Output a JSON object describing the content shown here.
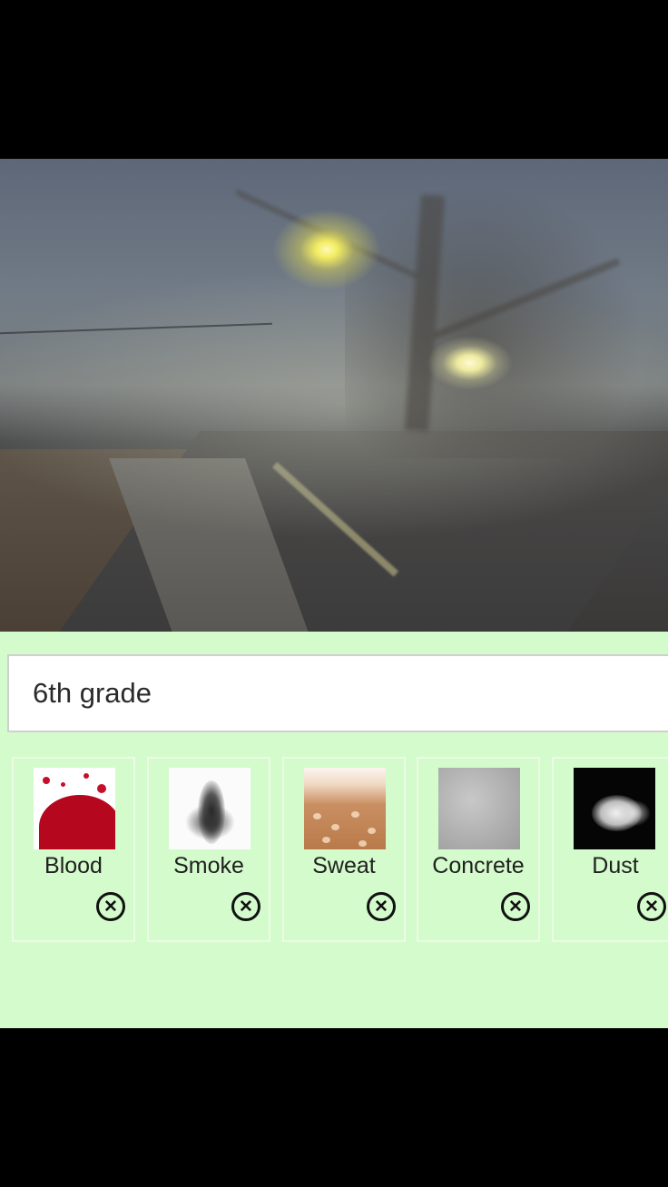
{
  "search": {
    "value": "6th grade"
  },
  "effects": [
    {
      "label": "Blood",
      "remove_icon": "close-circle-icon"
    },
    {
      "label": "Smoke",
      "remove_icon": "close-circle-icon"
    },
    {
      "label": "Sweat",
      "remove_icon": "close-circle-icon"
    },
    {
      "label": "Concrete",
      "remove_icon": "close-circle-icon"
    },
    {
      "label": "Dust",
      "remove_icon": "close-circle-icon"
    }
  ],
  "colors": {
    "panel_background": "#d4fbcc",
    "letterbox": "#000000"
  }
}
